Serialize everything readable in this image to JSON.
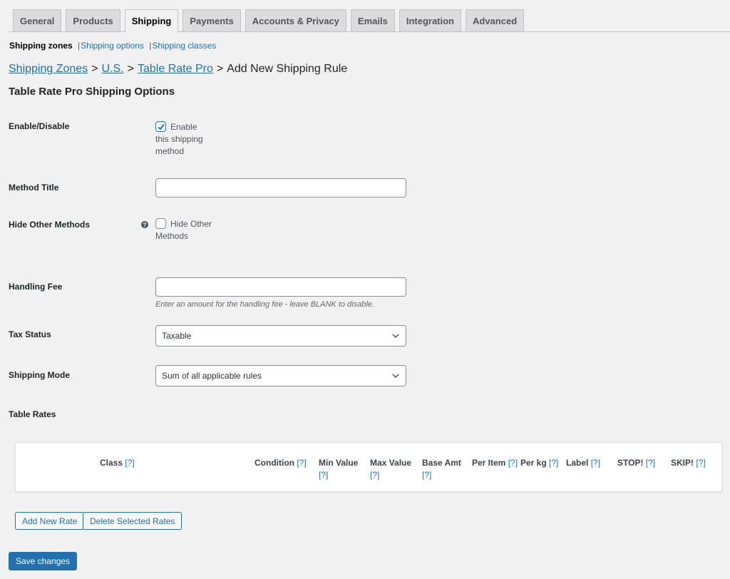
{
  "tabs": [
    {
      "label": "General",
      "active": false
    },
    {
      "label": "Products",
      "active": false
    },
    {
      "label": "Shipping",
      "active": true
    },
    {
      "label": "Payments",
      "active": false
    },
    {
      "label": "Accounts & Privacy",
      "active": false
    },
    {
      "label": "Emails",
      "active": false
    },
    {
      "label": "Integration",
      "active": false
    },
    {
      "label": "Advanced",
      "active": false
    }
  ],
  "subnav": {
    "current": "Shipping zones",
    "links": [
      "Shipping options",
      "Shipping classes"
    ]
  },
  "breadcrumb": {
    "links": [
      "Shipping Zones",
      "U.S.",
      "Table Rate Pro"
    ],
    "current": "Add New Shipping Rule",
    "separator": ">"
  },
  "section_title": "Table Rate Pro Shipping Options",
  "form": {
    "enable": {
      "label": "Enable/Disable",
      "checkbox_label": "Enable this shipping method",
      "checked": true
    },
    "method_title": {
      "label": "Method Title",
      "value": "",
      "placeholder": ""
    },
    "hide_other": {
      "label": "Hide Other Methods",
      "help_icon": "help-circle-icon",
      "checkbox_label": "Hide Other Methods",
      "checked": false
    },
    "handling_fee": {
      "label": "Handling Fee",
      "value": "",
      "description": "Enter an amount for the handling fee - leave BLANK to disable."
    },
    "tax_status": {
      "label": "Tax Status",
      "selected": "Taxable"
    },
    "shipping_mode": {
      "label": "Shipping Mode",
      "selected": "Sum of all applicable rules"
    }
  },
  "table_rates": {
    "label": "Table Rates",
    "help_marker": "[?]",
    "columns": [
      {
        "name": "Class",
        "help": "[?]"
      },
      {
        "name": "Condition",
        "help": "[?]"
      },
      {
        "name": "Min Value",
        "help": "[?]"
      },
      {
        "name": "Max Value",
        "help": "[?]"
      },
      {
        "name": "Base Amt",
        "help": "[?]"
      },
      {
        "name": "Per Item",
        "help": "[?]"
      },
      {
        "name": "Per kg",
        "help": "[?]"
      },
      {
        "name": "Label",
        "help": "[?]"
      },
      {
        "name": "STOP!",
        "help": "[?]"
      },
      {
        "name": "SKIP!",
        "help": "[?]"
      }
    ],
    "rows": []
  },
  "buttons": {
    "add_rate": "Add New Rate",
    "delete_rates": "Delete Selected Rates",
    "save": "Save changes"
  },
  "colors": {
    "accent": "#2271b1",
    "background": "#f1f1f1"
  }
}
